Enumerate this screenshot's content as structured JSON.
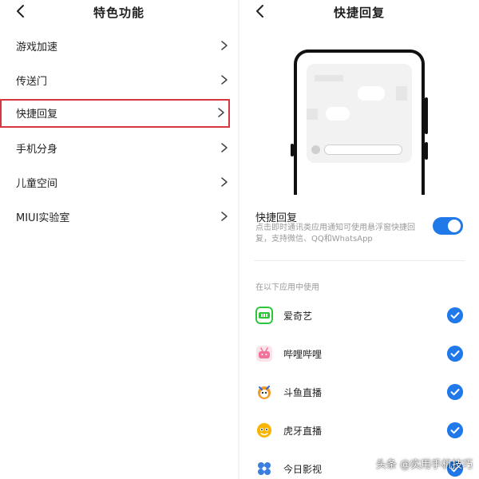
{
  "left_panel": {
    "title": "特色功能",
    "menu": [
      {
        "label": "游戏加速"
      },
      {
        "label": "传送门"
      },
      {
        "label": "快捷回复"
      },
      {
        "label": "手机分身"
      },
      {
        "label": "儿童空间"
      },
      {
        "label": "MIUI实验室"
      }
    ],
    "selected_index": 2
  },
  "right_panel": {
    "title": "快捷回复",
    "setting": {
      "title": "快捷回复",
      "description": "点击即时通讯类应用通知可使用悬浮窗快捷回复，支持微信、QQ和WhatsApp",
      "enabled": true
    },
    "section_label": "在以下应用中使用",
    "apps": [
      {
        "name": "爱奇艺",
        "icon": "iqiyi-icon",
        "checked": true
      },
      {
        "name": "哔哩哔哩",
        "icon": "bilibili-icon",
        "checked": true
      },
      {
        "name": "斗鱼直播",
        "icon": "douyu-icon",
        "checked": true
      },
      {
        "name": "虎牙直播",
        "icon": "huya-icon",
        "checked": true
      },
      {
        "name": "今日影视",
        "icon": "jinri-yingshi-icon",
        "checked": true
      }
    ]
  },
  "watermark": "头条 @实用手机技巧",
  "colors": {
    "accent": "#1f79e8",
    "highlight_border": "#d6363f",
    "text_primary": "#1f1f1f",
    "text_secondary": "#9a9a9a"
  }
}
